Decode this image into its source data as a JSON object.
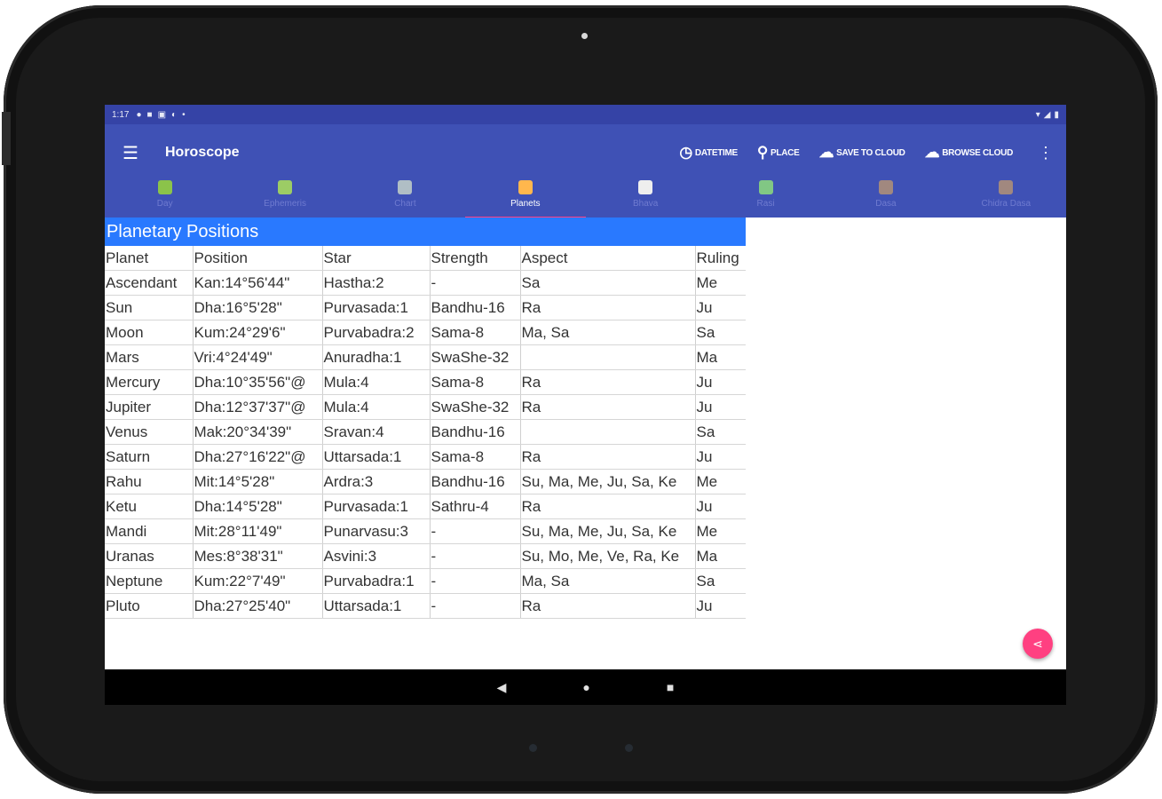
{
  "status_bar": {
    "time": "1:17"
  },
  "app_bar": {
    "title": "Horoscope",
    "actions": [
      {
        "label": "DATETIME",
        "icon": "clock-icon"
      },
      {
        "label": "PLACE",
        "icon": "location-pin-icon"
      },
      {
        "label": "SAVE TO CLOUD",
        "icon": "cloud-upload-icon"
      },
      {
        "label": "BROWSE CLOUD",
        "icon": "cloud-download-icon"
      }
    ]
  },
  "tabs": [
    {
      "label": "Day",
      "icon_color": "#8bc34a",
      "active": false
    },
    {
      "label": "Ephemeris",
      "icon_color": "#9ccc65",
      "active": false
    },
    {
      "label": "Chart",
      "icon_color": "#b0bec5",
      "active": false
    },
    {
      "label": "Planets",
      "icon_color": "#ffb74d",
      "active": true
    },
    {
      "label": "Bhava",
      "icon_color": "#eeeeee",
      "active": false
    },
    {
      "label": "Rasi",
      "icon_color": "#81c784",
      "active": false
    },
    {
      "label": "Dasa",
      "icon_color": "#a1887f",
      "active": false
    },
    {
      "label": "Chidra Dasa",
      "icon_color": "#a1887f",
      "active": false
    }
  ],
  "section_title": "Planetary Positions",
  "table": {
    "headers": [
      "Planet",
      "Position",
      "Star",
      "Strength",
      "Aspect",
      "Ruling"
    ],
    "rows": [
      [
        "Ascendant",
        "Kan:14°56'44\"",
        "Hastha:2",
        "-",
        "Sa",
        "Me"
      ],
      [
        "Sun",
        "Dha:16°5'28\"",
        "Purvasada:1",
        "Bandhu-16",
        "Ra",
        "Ju"
      ],
      [
        "Moon",
        "Kum:24°29'6\"",
        "Purvabadra:2",
        "Sama-8",
        "Ma, Sa",
        "Sa"
      ],
      [
        "Mars",
        "Vri:4°24'49\"",
        "Anuradha:1",
        "SwaShe-32",
        "",
        "Ma"
      ],
      [
        "Mercury",
        "Dha:10°35'56\"@",
        "Mula:4",
        "Sama-8",
        "Ra",
        "Ju"
      ],
      [
        "Jupiter",
        "Dha:12°37'37\"@",
        "Mula:4",
        "SwaShe-32",
        "Ra",
        "Ju"
      ],
      [
        "Venus",
        "Mak:20°34'39\"",
        "Sravan:4",
        "Bandhu-16",
        "",
        "Sa"
      ],
      [
        "Saturn",
        "Dha:27°16'22\"@",
        "Uttarsada:1",
        "Sama-8",
        "Ra",
        "Ju"
      ],
      [
        "Rahu",
        "Mit:14°5'28\"",
        "Ardra:3",
        "Bandhu-16",
        "Su, Ma, Me, Ju, Sa, Ke",
        "Me"
      ],
      [
        "Ketu",
        "Dha:14°5'28\"",
        "Purvasada:1",
        "Sathru-4",
        "Ra",
        "Ju"
      ],
      [
        "Mandi",
        "Mit:28°11'49\"",
        "Punarvasu:3",
        "-",
        "Su, Ma, Me, Ju, Sa, Ke",
        "Me"
      ],
      [
        "Uranas",
        "Mes:8°38'31\"",
        "Asvini:3",
        "-",
        "Su, Mo, Me, Ve, Ra, Ke",
        "Ma"
      ],
      [
        "Neptune",
        "Kum:22°7'49\"",
        "Purvabadra:1",
        "-",
        "Ma, Sa",
        "Sa"
      ],
      [
        "Pluto",
        "Dha:27°25'40\"",
        "Uttarsada:1",
        "-",
        "Ra",
        "Ju"
      ]
    ]
  },
  "colors": {
    "primary": "#3f51b5",
    "primary_dark": "#3543a6",
    "accent": "#ff4081",
    "section_header": "#2979ff"
  }
}
